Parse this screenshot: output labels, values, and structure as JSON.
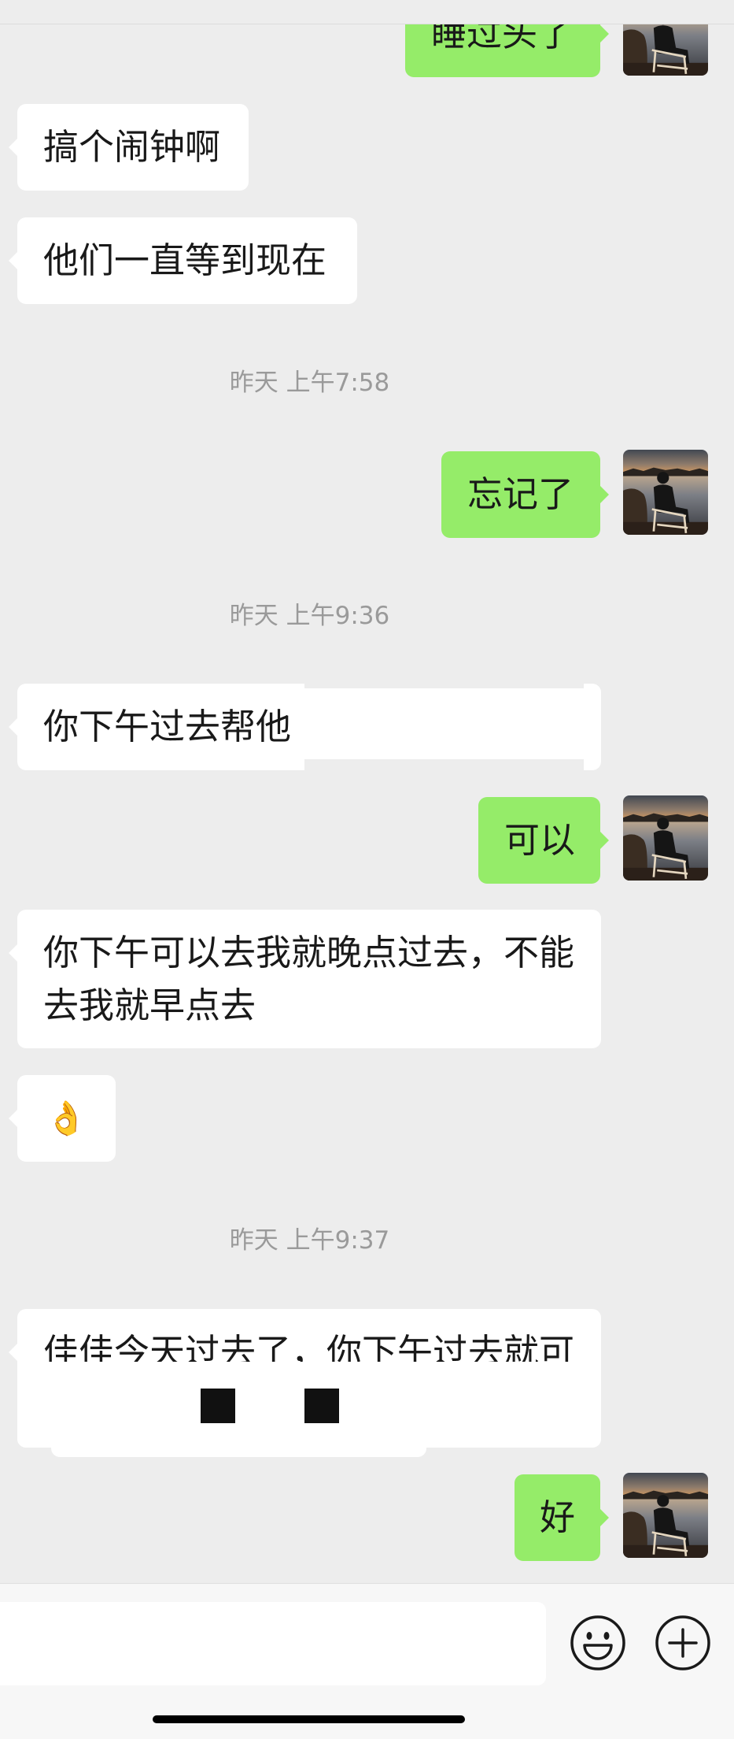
{
  "colors": {
    "background": "#ededed",
    "bubble_outgoing": "#95ec69",
    "bubble_incoming": "#ffffff",
    "text": "#191919",
    "timestamp": "#9a9a9a",
    "input_bar": "#f7f7f7",
    "redaction": "#111111"
  },
  "avatar_icon": "person-sunset-avatar",
  "messages": [
    {
      "outgoing": true,
      "text": "睡过头了"
    },
    {
      "outgoing": false,
      "text": "搞个闹钟啊"
    },
    {
      "outgoing": false,
      "text": "他们一直等到现在"
    },
    {
      "timestamp": "昨天 上午7:58"
    },
    {
      "outgoing": true,
      "text": "忘记了"
    },
    {
      "timestamp": "昨天 上午9:36"
    },
    {
      "outgoing": false,
      "text": "你下午过去帮他"
    },
    {
      "outgoing": true,
      "text": "可以"
    },
    {
      "outgoing": false,
      "lines": [
        "你下午可以去我就晚点过去，不能",
        "去我就早点去"
      ]
    },
    {
      "outgoing": false,
      "text": "👌"
    },
    {
      "timestamp": "昨天 上午9:37"
    },
    {
      "outgoing": false,
      "text": "佳佳今天过去了，你下午过去就可"
    },
    {
      "outgoing": true,
      "text": "好"
    }
  ],
  "input_bar": {
    "emoji_icon": "smiley-icon",
    "more_icon": "plus-icon"
  }
}
